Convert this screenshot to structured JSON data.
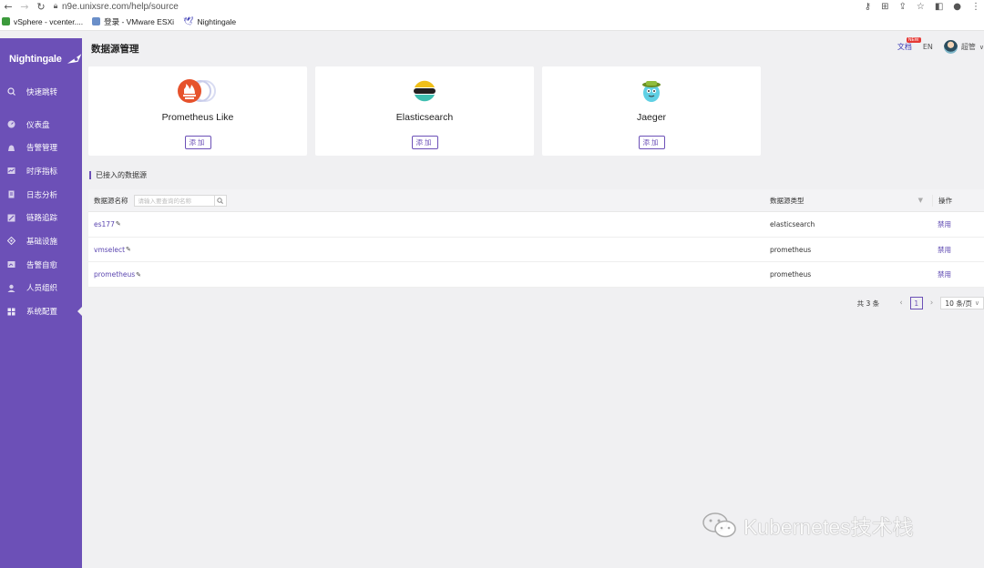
{
  "browser": {
    "url": "n9e.unixsre.com/help/source",
    "bookmarks": [
      {
        "label": "vSphere - vcenter....",
        "color": "#3c9a3c"
      },
      {
        "label": "登录 - VMware ESXi",
        "color": "#6a8fc9"
      },
      {
        "label": "Nightingale",
        "color": "#3b3bb5"
      }
    ]
  },
  "sidebar": {
    "logo": "Nightingale",
    "items": [
      {
        "label": "快速跳转",
        "icon": "search-icon"
      },
      {
        "label": "仪表盘",
        "icon": "dashboard-icon"
      },
      {
        "label": "告警管理",
        "icon": "alarm-icon"
      },
      {
        "label": "时序指标",
        "icon": "metrics-icon"
      },
      {
        "label": "日志分析",
        "icon": "log-icon"
      },
      {
        "label": "链路追踪",
        "icon": "trace-icon"
      },
      {
        "label": "基础设施",
        "icon": "infra-icon"
      },
      {
        "label": "告警自愈",
        "icon": "heal-icon"
      },
      {
        "label": "人员组织",
        "icon": "user-icon"
      },
      {
        "label": "系统配置",
        "icon": "settings-icon"
      }
    ],
    "active_index": 9
  },
  "header": {
    "title": "数据源管理",
    "doc_label": "文档",
    "new_badge": "NEW",
    "lang": "EN",
    "user": "超管"
  },
  "cards": [
    {
      "title": "Prometheus Like",
      "button": "添加",
      "icon": "prometheus-logo"
    },
    {
      "title": "Elasticsearch",
      "button": "添加",
      "icon": "elasticsearch-logo"
    },
    {
      "title": "Jaeger",
      "button": "添加",
      "icon": "jaeger-logo"
    }
  ],
  "section": {
    "title": "已接入的数据源"
  },
  "table": {
    "col_name": "数据源名称",
    "search_placeholder": "请输入要查询的名称",
    "col_type": "数据源类型",
    "col_op": "操作",
    "rows": [
      {
        "name": "es177",
        "type": "elasticsearch",
        "op": "禁用"
      },
      {
        "name": "vmselect",
        "type": "prometheus",
        "op": "禁用"
      },
      {
        "name": "prometheus",
        "type": "prometheus",
        "op": "禁用"
      }
    ]
  },
  "pagination": {
    "total": "共 3 条",
    "current": "1",
    "page_size": "10 条/页"
  },
  "watermark": "Kubernetes技术栈"
}
